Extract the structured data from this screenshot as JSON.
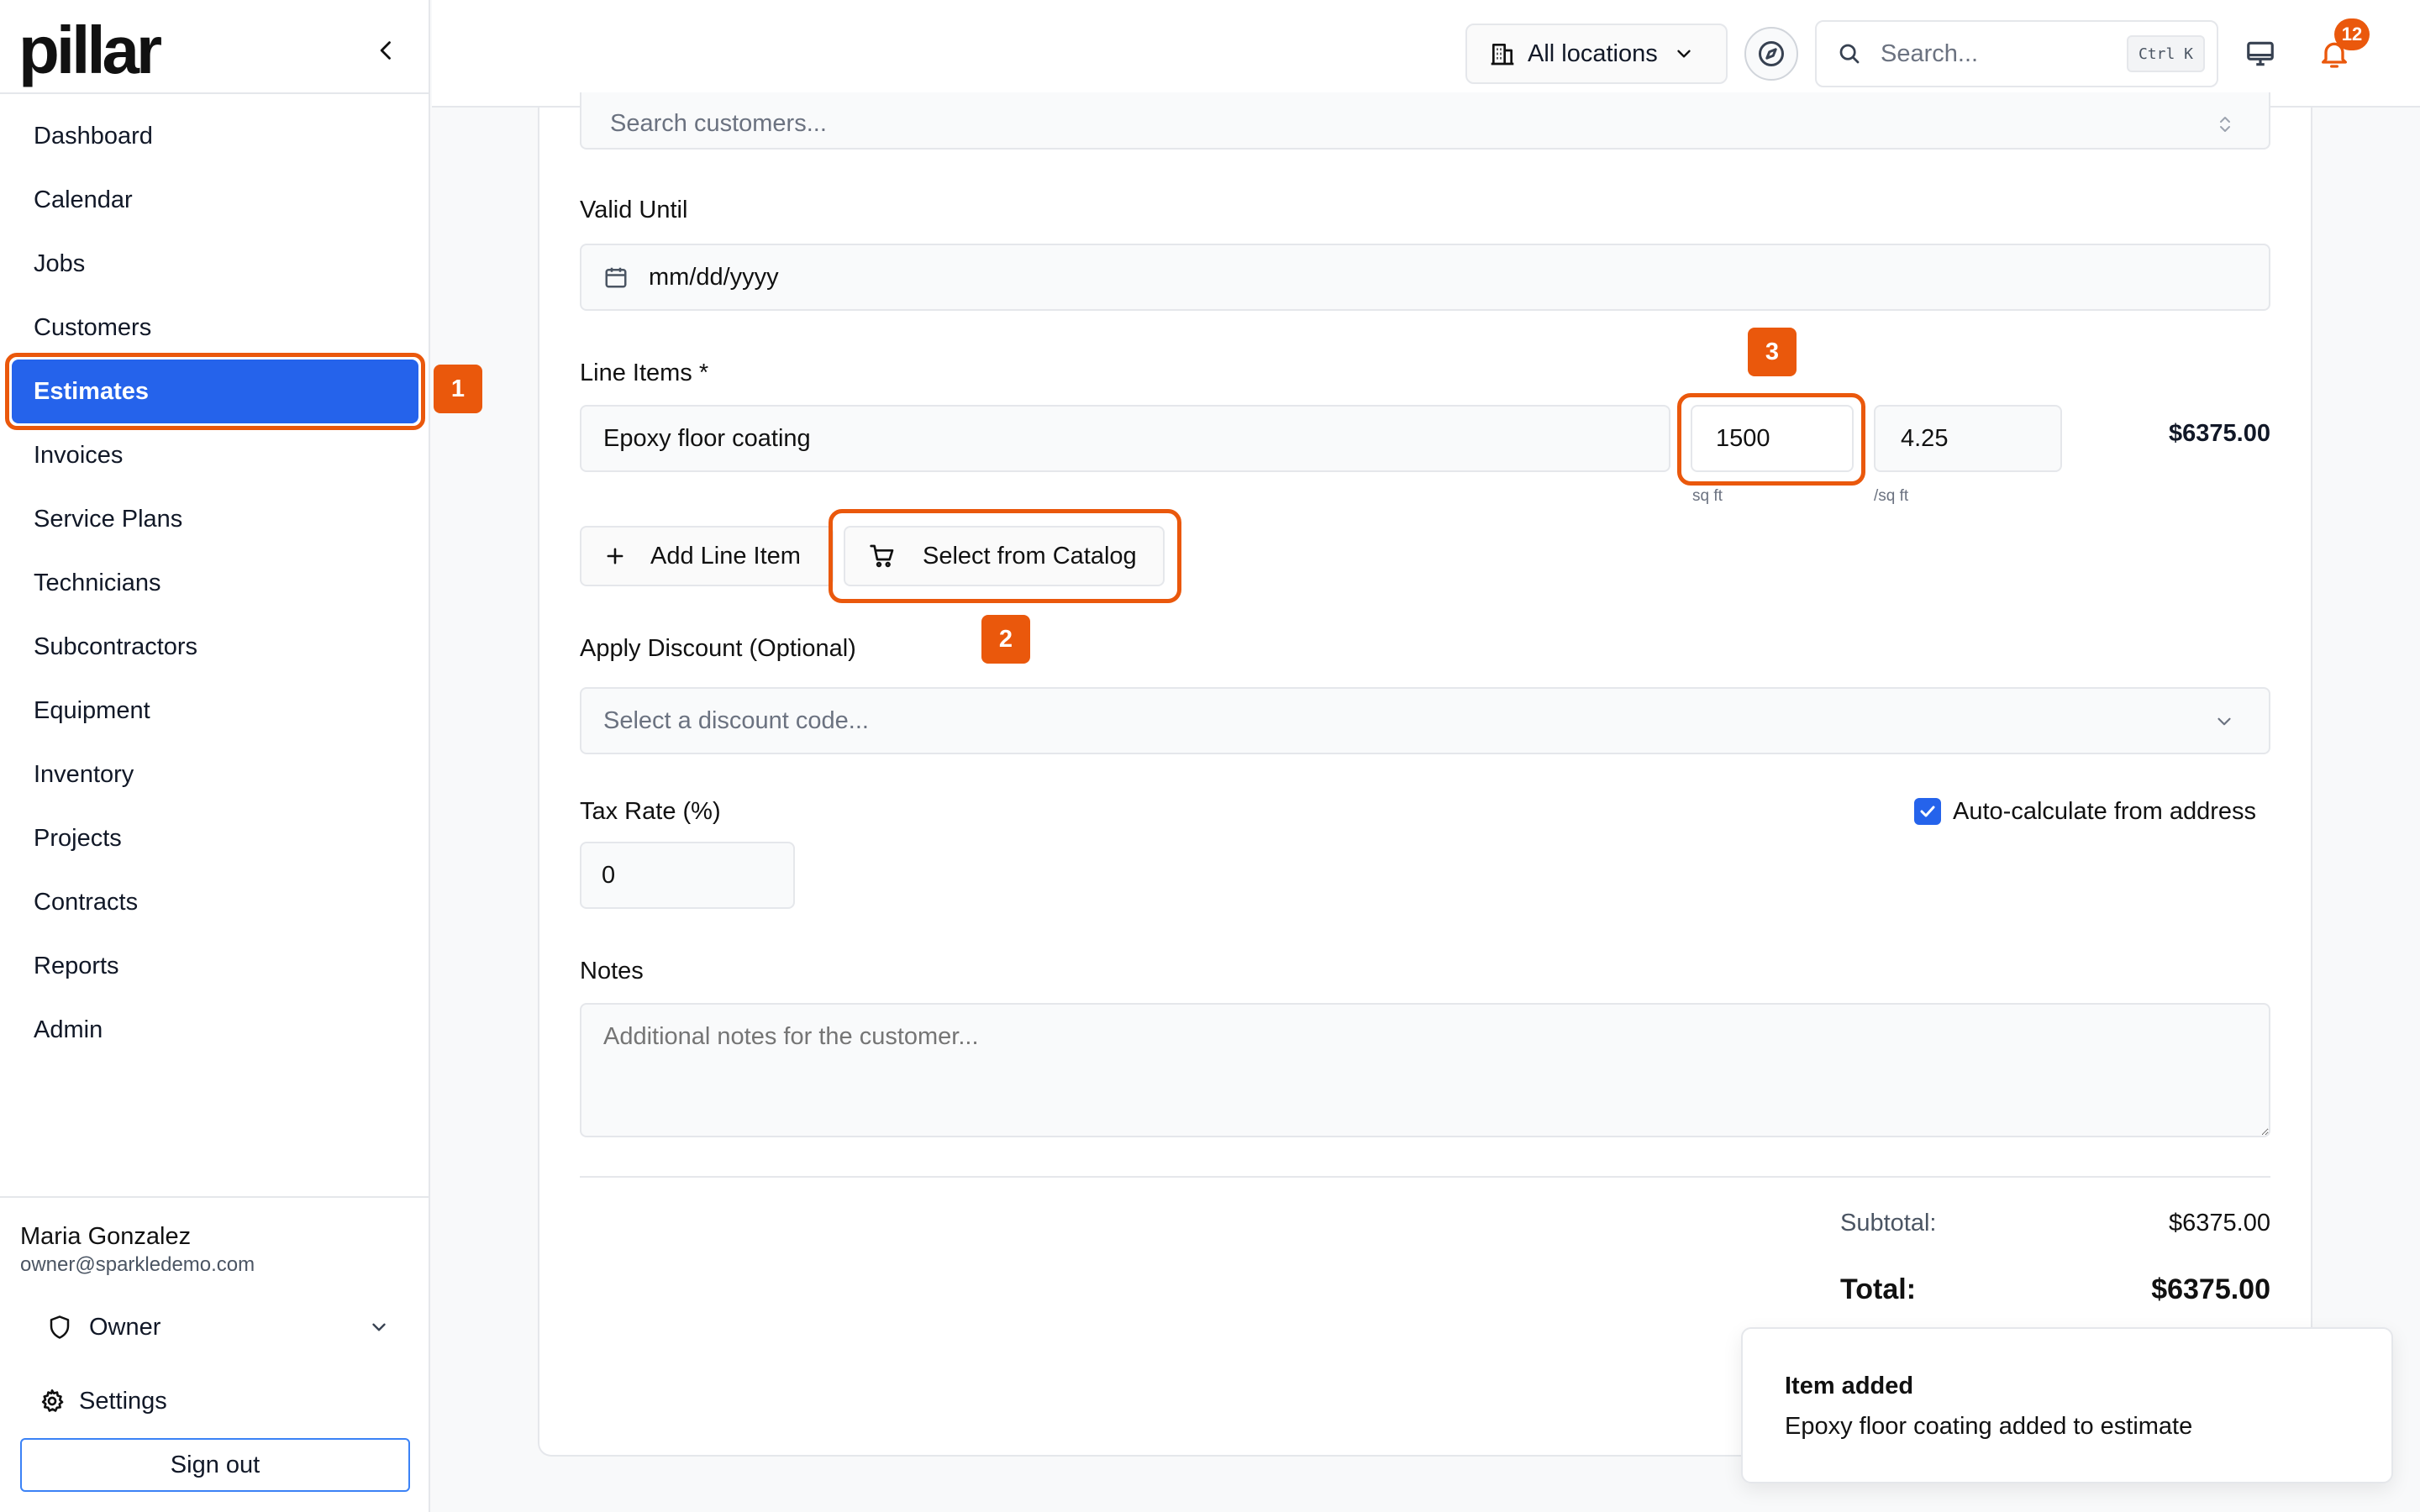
{
  "brand": {
    "name": "pillar"
  },
  "sidebar": {
    "items": [
      {
        "label": "Dashboard"
      },
      {
        "label": "Calendar"
      },
      {
        "label": "Jobs"
      },
      {
        "label": "Customers"
      },
      {
        "label": "Estimates",
        "active": true
      },
      {
        "label": "Invoices"
      },
      {
        "label": "Service Plans"
      },
      {
        "label": "Technicians"
      },
      {
        "label": "Subcontractors"
      },
      {
        "label": "Equipment"
      },
      {
        "label": "Inventory"
      },
      {
        "label": "Projects"
      },
      {
        "label": "Contracts"
      },
      {
        "label": "Reports"
      },
      {
        "label": "Admin"
      }
    ],
    "user": {
      "name": "Maria Gonzalez",
      "email": "owner@sparkledemo.com",
      "role": "Owner"
    },
    "settings_label": "Settings",
    "signout_label": "Sign out"
  },
  "topbar": {
    "location_label": "All locations",
    "search_placeholder": "Search...",
    "search_shortcut": "Ctrl K",
    "notification_count": "12"
  },
  "form": {
    "customer_search_placeholder": "Search customers...",
    "valid_until_label": "Valid Until",
    "valid_until_placeholder": "mm/dd/yyyy",
    "line_items_label": "Line Items *",
    "line_item": {
      "description": "Epoxy floor coating",
      "quantity": "1500",
      "quantity_unit": "sq ft",
      "rate": "4.25",
      "rate_unit": "/sq ft",
      "amount": "$6375.00"
    },
    "add_line_item_label": "Add Line Item",
    "select_catalog_label": "Select from Catalog",
    "discount_label": "Apply Discount (Optional)",
    "discount_placeholder": "Select a discount code...",
    "tax_label": "Tax Rate (%)",
    "tax_value": "0",
    "auto_calc_label": "Auto-calculate from address",
    "auto_calc_checked": true,
    "notes_label": "Notes",
    "notes_placeholder": "Additional notes for the customer...",
    "subtotal_label": "Subtotal:",
    "subtotal_value": "$6375.00",
    "total_label": "Total:",
    "total_value": "$6375.00"
  },
  "annotations": {
    "marker1": "1",
    "marker2": "2",
    "marker3": "3"
  },
  "toast": {
    "title": "Item added",
    "message": "Epoxy floor coating added to estimate"
  },
  "colors": {
    "accent": "#2563eb",
    "highlight": "#ea580c"
  }
}
